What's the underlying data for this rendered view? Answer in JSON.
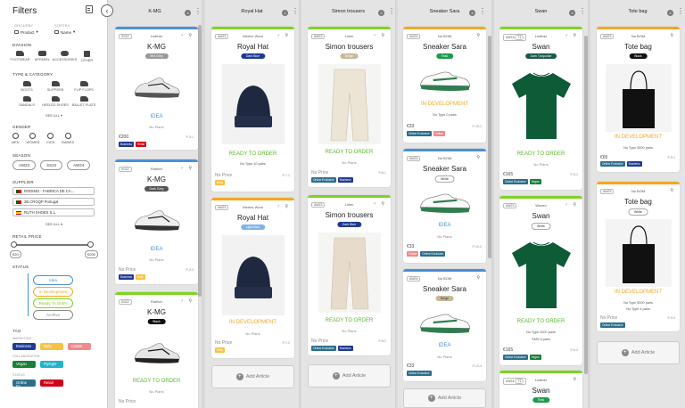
{
  "sidebar": {
    "title": "Filters",
    "groupby_label": "GROUPBY",
    "groupby_value": "Product",
    "sortby_label": "SORTBY",
    "sortby_value": "Name",
    "division_label": "DIVISION",
    "divisions": [
      "FOOTWEAR",
      "APPAREL",
      "ACCESSORIES",
      "OTHER"
    ],
    "type_label": "TYPE & CATEGORY",
    "types": [
      "BOOTS",
      "SLIPPERS",
      "FLIP FLOPS",
      "SANDALS",
      "HEELED SHOES",
      "BALLET FLATS"
    ],
    "see_all": "SEE ALL",
    "gender_label": "GENDER",
    "genders": [
      "MEN",
      "WOMEN",
      "KIDS",
      "BABIES"
    ],
    "season_label": "SEASON",
    "seasons": [
      "AW23",
      "SS22",
      "AW24"
    ],
    "supplier_label": "SUPPLIER",
    "suppliers": [
      "RODIMO - FABRICA DE CA...",
      "2B CROQP Portugal",
      "RUTH SHOES S.L."
    ],
    "retail_label": "RETAIL PRICE",
    "price_min": "€20",
    "price_max": "€200",
    "status_label": "STATUS",
    "statuses": [
      {
        "label": "Idea",
        "color": "#4a90d9"
      },
      {
        "label": "In Development",
        "color": "#f5a623"
      },
      {
        "label": "Ready To Order",
        "color": "#7ed321"
      },
      {
        "label": "Archive",
        "color": "#888888"
      }
    ],
    "tag_label": "TAG",
    "tag_cat1": "MARKETING",
    "tags1": [
      {
        "label": "Business",
        "color": "#1f3a93"
      },
      {
        "label": "Bally",
        "color": "#f5c242"
      },
      {
        "label": "Cotton",
        "color": "#f08a8a"
      }
    ],
    "tag_cat2": "COLLABORATION",
    "tags2": [
      {
        "label": "Vegan",
        "color": "#1a7f37"
      },
      {
        "label": "Flyingle",
        "color": "#1fb3c8"
      }
    ],
    "tag_cat3": "STATUS",
    "tags3": [
      {
        "label": "Online Ex...",
        "color": "#2c6e8c"
      },
      {
        "label": "Retail",
        "color": "#d0021b"
      }
    ]
  },
  "columns": [
    {
      "name": "K-MG",
      "count": "3"
    },
    {
      "name": "Royal Hat",
      "count": "2"
    },
    {
      "name": "Simon trousers",
      "count": "2"
    },
    {
      "name": "Sneaker Sara",
      "count": "3"
    },
    {
      "name": "Swan",
      "count": "3"
    },
    {
      "name": "Tote bag",
      "count": "2"
    }
  ],
  "add_article": "Add Article",
  "cards": {
    "kmg1": {
      "id": "SS22",
      "mat": "Leather",
      "title": "K-MG",
      "color": "Mid Grey",
      "status": "IDEA",
      "noplans": "No Plans",
      "price": "€200",
      "pid": "P-3-1",
      "tags": [
        "Business",
        "Retail"
      ]
    },
    "kmg2": {
      "id": "SS22",
      "mat": "Rubber",
      "title": "K-MG",
      "color": "Dark Grey",
      "status": "IDEA",
      "noplans": "No Plans",
      "price": "No Price",
      "pid": "P-3-3",
      "tags": [
        "Business",
        "Bally"
      ]
    },
    "kmg3": {
      "id": "SS22",
      "mat": "Rubber",
      "title": "K-MG",
      "color": "Black",
      "status": "READY TO ORDER",
      "noplans": "No Plans",
      "price": "No Price"
    },
    "hat1": {
      "id": "AW23",
      "mat": "Merino Wool",
      "title": "Royal Hat",
      "color": "Dark Blue",
      "status": "READY TO ORDER",
      "extra": "No Type   10 pairs",
      "price": "No Price",
      "pid": "P-7-1",
      "tags": [
        "Bally"
      ]
    },
    "hat2": {
      "id": "AW23",
      "mat": "Merino Wool",
      "title": "Royal Hat",
      "color": "Light Blue",
      "status": "IN DEVELOPMENT",
      "noplans": "No Plans",
      "price": "No Price",
      "pid": "P-7-2",
      "tags": [
        "Bally"
      ]
    },
    "tr1": {
      "id": "AW23",
      "mat": "Linen",
      "title": "Simon trousers",
      "color": "Beige",
      "status": "READY TO ORDER",
      "noplans": "No Plans",
      "price": "No Price",
      "pid": "P-8-1",
      "tags": [
        "Online Exclusive",
        "Business"
      ]
    },
    "tr2": {
      "id": "AW23",
      "mat": "Linen",
      "title": "Simon trousers",
      "color": "Dark Blue",
      "status": "READY TO ORDER",
      "noplans": "No Plans",
      "price": "No Price",
      "pid": "P-8-2",
      "tags": [
        "Online Exclusive",
        "Business"
      ]
    },
    "sn1": {
      "id": "AW24",
      "mat": "No BOM",
      "title": "Sneaker Sara",
      "color": "Teak",
      "status": "IN DEVELOPMENT",
      "extra": "No Type   0 pairs",
      "price": "€33",
      "pid": "P-10-1",
      "tags": [
        "Online Exclusive",
        "Cotton"
      ]
    },
    "sn2": {
      "id": "AW24",
      "mat": "No BOM",
      "title": "Sneaker Sara",
      "color": "White",
      "status": "IDEA",
      "noplans": "No Plans",
      "price": "€33",
      "pid": "P-10-2",
      "tags": [
        "Cotton",
        "Online Exclusive"
      ]
    },
    "sn3": {
      "id": "AW24",
      "mat": "No BOM",
      "title": "Sneaker Sara",
      "color": "Beige",
      "status": "IDEA",
      "noplans": "No Plans",
      "price": "€33",
      "pid": "P-10-3",
      "tags": [
        "Online Exclusive"
      ]
    },
    "sw1": {
      "id": "AW23",
      "badge": "+1",
      "mat": "Leather",
      "title": "Swan",
      "color": "Dark Turquoise",
      "status": "READY TO ORDER",
      "noplans": "No Plans",
      "price": "€165",
      "pid": "P-5-1",
      "tags": [
        "Online Exclusive",
        "Vegan"
      ]
    },
    "sw2": {
      "id": "AW23",
      "mat": "Woven",
      "title": "Swan",
      "color": "White",
      "status": "READY TO ORDER",
      "extra": "No Type   2000 pairs",
      "extra2": "SMS   6 pairs",
      "price": "€165",
      "pid": "P-5-2",
      "tags": [
        "Online Exclusive",
        "Vegan"
      ]
    },
    "sw3": {
      "id": "AW24",
      "badge": "+1",
      "mat": "Leather",
      "title": "Swan",
      "color": "Teak"
    },
    "tb1": {
      "id": "AW23",
      "mat": "No BOM",
      "title": "Tote bag",
      "color": "Black",
      "status": "IN DEVELOPMENT",
      "extra": "No Type   5000 pairs",
      "price": "€65",
      "pid": "P-9-1",
      "tags": [
        "Online Exclusive",
        "Business"
      ]
    },
    "tb2": {
      "id": "AW23",
      "mat": "No BOM",
      "title": "Tote bag",
      "color": "White",
      "status": "IN DEVELOPMENT",
      "extra": "No Type   5000 pairs",
      "extra2": "No Type   4 pairs",
      "price": "No Price",
      "pid": "P-9-2",
      "tags": [
        "Online Exclusive"
      ]
    }
  }
}
